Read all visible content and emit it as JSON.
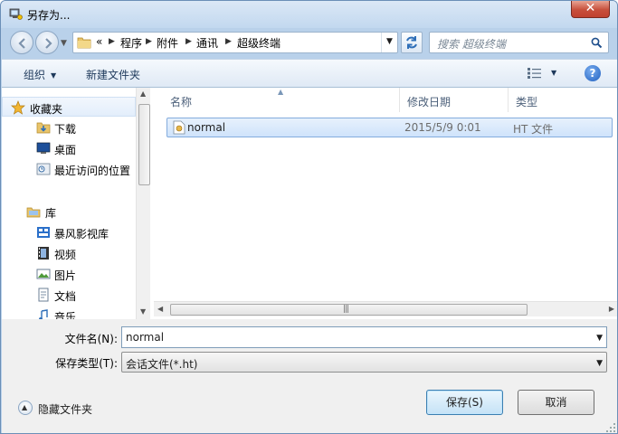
{
  "window": {
    "title": "另存为..."
  },
  "address": {
    "overflow": "«",
    "crumbs": [
      "程序",
      "附件",
      "通讯",
      "超级终端"
    ]
  },
  "search": {
    "placeholder": "搜索 超级终端"
  },
  "toolbar": {
    "organize": "组织",
    "new_folder": "新建文件夹",
    "help": "?"
  },
  "nav": {
    "favorites": "收藏夹",
    "items": [
      "下载",
      "桌面",
      "最近访问的位置"
    ],
    "library": "库",
    "library_items": [
      "暴风影视库",
      "视频",
      "图片",
      "文档",
      "音乐"
    ]
  },
  "columns": {
    "name": "名称",
    "modified": "修改日期",
    "type": "类型"
  },
  "files": [
    {
      "name": "normal",
      "modified": "2015/5/9 0:01",
      "type": "HT 文件"
    }
  ],
  "form": {
    "filename_label": "文件名(N):",
    "filename_value": "normal",
    "filetype_label": "保存类型(T):",
    "filetype_value": "会话文件(*.ht)"
  },
  "footer": {
    "hide_folders": "隐藏文件夹",
    "save": "保存(S)",
    "cancel": "取消"
  }
}
